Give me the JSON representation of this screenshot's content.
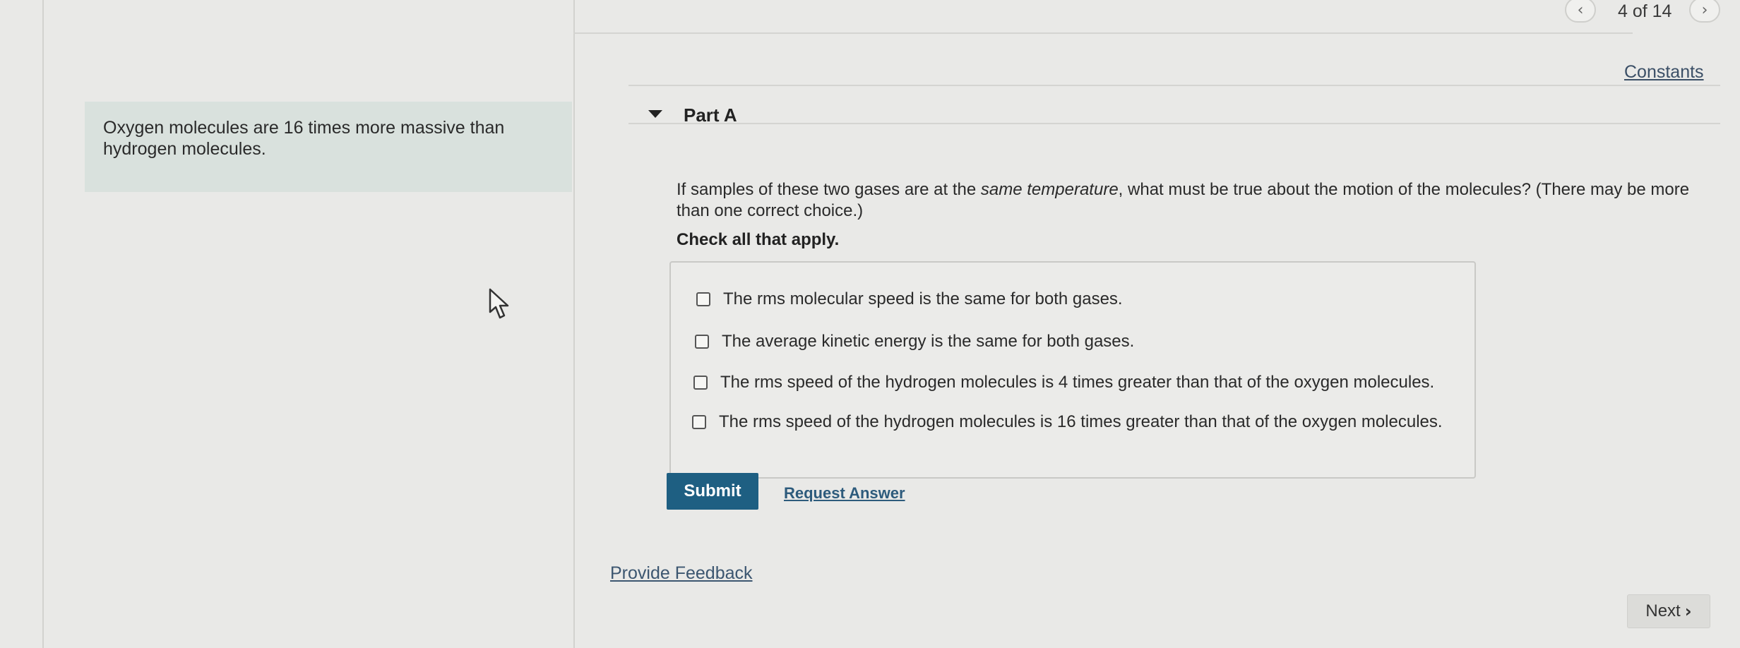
{
  "nav": {
    "prev_icon": "chevron-left-icon",
    "next_icon": "chevron-right-icon",
    "counter": "4 of 14"
  },
  "header": {
    "constants_label": "Constants"
  },
  "intro": {
    "text": "Oxygen molecules are 16 times more massive than hydrogen molecules."
  },
  "part": {
    "title": "Part A",
    "question_before": "If samples of these two gases are at the ",
    "question_emphasis": "same temperature",
    "question_after": ", what must be true about the motion of the molecules? (There may be more than one correct choice.)",
    "instruction": "Check all that apply.",
    "choices": [
      {
        "label": "The rms molecular speed is the same for both gases.",
        "checked": false
      },
      {
        "label": "The average kinetic energy is the same for both gases.",
        "checked": false
      },
      {
        "label": "The rms speed of the hydrogen molecules is 4 times greater than that of the oxygen molecules.",
        "checked": false
      },
      {
        "label": "The rms speed of the hydrogen molecules is 16 times greater than that of the oxygen molecules.",
        "checked": false
      }
    ]
  },
  "actions": {
    "submit_label": "Submit",
    "request_answer_label": "Request Answer"
  },
  "footer": {
    "feedback_label": "Provide Feedback",
    "next_label": "Next"
  },
  "colors": {
    "submit_bg": "#1e5f82",
    "intro_bg": "#d9e1dd",
    "link": "#2d5b7c"
  }
}
